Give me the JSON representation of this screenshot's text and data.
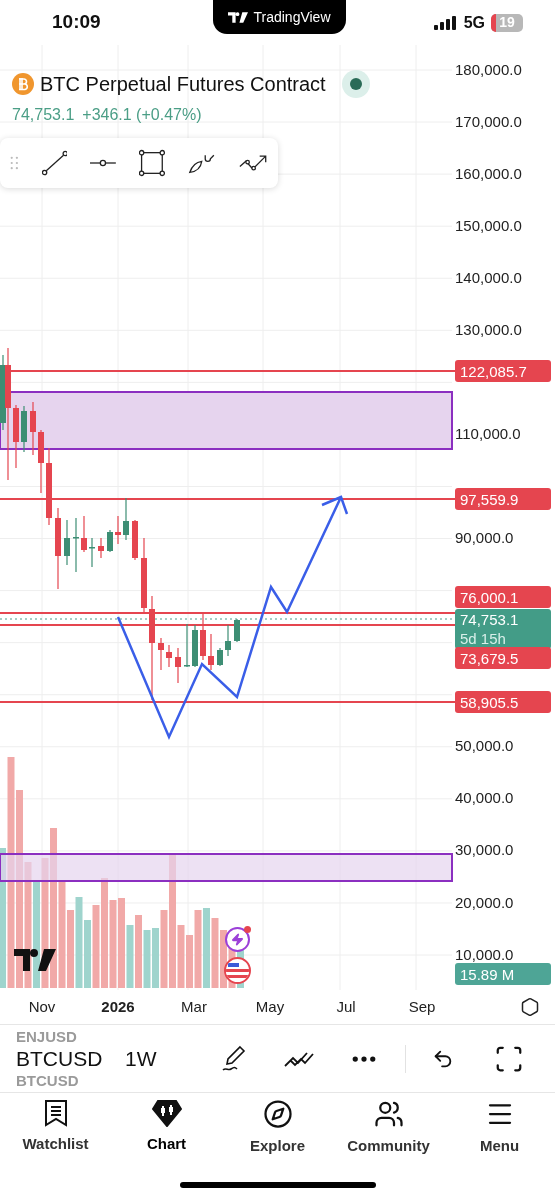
{
  "status_bar": {
    "time": "10:09",
    "network": "5G",
    "battery": "19"
  },
  "notch_banner": {
    "label": "TradingView"
  },
  "symbol_header": {
    "title": "BTC Perpetual Futures Contract",
    "price": "74,753.1",
    "change": "+346.1 (+0.47%)"
  },
  "price_axis": {
    "ticks": [
      "180,000.0",
      "170,000.0",
      "160,000.0",
      "150,000.0",
      "140,000.0",
      "130,000.0",
      "110,000.0",
      "90,000.0",
      "50,000.0",
      "40,000.0",
      "30,000.0",
      "20,000.0",
      "10,000.0"
    ]
  },
  "price_tags": [
    {
      "kind": "level",
      "text": "122,085.7"
    },
    {
      "kind": "level",
      "text": "97,559.9"
    },
    {
      "kind": "level",
      "text": "76,000.1"
    },
    {
      "kind": "last",
      "text": "74,753.1",
      "subtext": "5d 15h"
    },
    {
      "kind": "level",
      "text": "73,679.5"
    },
    {
      "kind": "level",
      "text": "58,905.5"
    },
    {
      "kind": "volume",
      "text": "15.89 M"
    }
  ],
  "time_axis": [
    {
      "kind": "month",
      "label": "Nov"
    },
    {
      "kind": "year",
      "label": "2026"
    },
    {
      "kind": "month",
      "label": "Mar"
    },
    {
      "kind": "month",
      "label": "May"
    },
    {
      "kind": "month",
      "label": "Jul"
    },
    {
      "kind": "month",
      "label": "Sep"
    }
  ],
  "toolbar": {
    "symbols": [
      {
        "text": "ENJUSD",
        "selected": false
      },
      {
        "text": "BTCUSD",
        "selected": true
      },
      {
        "text": "BTCUSD",
        "selected": false
      }
    ],
    "interval": "1W"
  },
  "tabs": [
    {
      "label": "Watchlist",
      "selected": false
    },
    {
      "label": "Chart",
      "selected": true
    },
    {
      "label": "Explore",
      "selected": false
    },
    {
      "label": "Community",
      "selected": false
    },
    {
      "label": "Menu",
      "selected": false
    }
  ]
}
